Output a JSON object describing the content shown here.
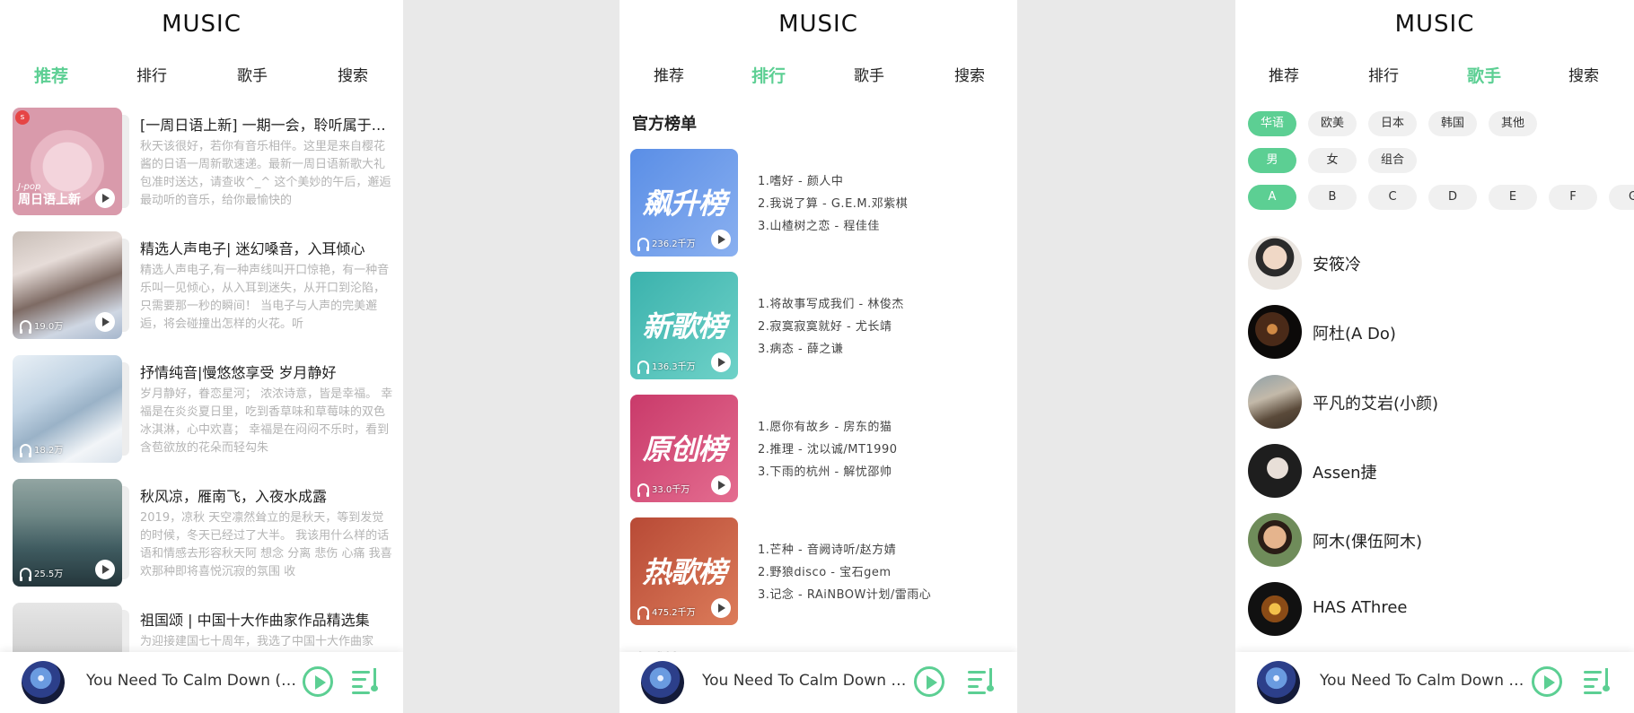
{
  "app_title": "MUSIC",
  "tabs": [
    "推荐",
    "排行",
    "歌手",
    "搜索"
  ],
  "recommend": {
    "items": [
      {
        "title": "[一周日语上新] 一期一会，聆听属于你的日语",
        "desc": "秋天该很好，若你有音乐相伴。这里是来自樱花酱的日语一周新歌速递。最新一周日语新歌大礼包准时送达，请查收^_^ 这个美妙的午后，邂逅最动听的音乐，给你最愉快的",
        "count": "",
        "cover_text": "周日语上新",
        "cover_small": "J-pop",
        "cover_badge": "s"
      },
      {
        "title": "精选人声电子| 迷幻嗓音，入耳倾心",
        "desc": "精选人声电子,有一种声线叫开口惊艳，有一种音乐叫一见倾心，从入耳到迷失，从开口到沦陷，只需要那一秒的瞬间！ 当电子与人声的完美邂逅，将会碰撞出怎样的火花。听",
        "count": "19.0万"
      },
      {
        "title": "抒情纯音|慢悠悠享受 岁月静好",
        "desc": "岁月静好，眷恋星河； 浓浓诗意，皆是幸福。 幸福是在炎炎夏日里，吃到香草味和草莓味的双色冰淇淋，心中欢喜； 幸福是在闷闷不乐时，看到含苞欲放的花朵而轻勾朱",
        "count": "18.2万"
      },
      {
        "title": "秋风凉，雁南飞，入夜水成露",
        "desc": "2019，凉秋 天空凛然耸立的是秋天，等到发觉的时候，冬天已经过了大半。 我该用什么样的话语和情感去形容秋天阿 想念 分离 悲伤 心痛 我喜欢那种即将喜悦沉寂的氛围 收",
        "count": "25.5万"
      },
      {
        "title": "祖国颂 | 中国十大作曲家作品精选集",
        "desc": "为迎接建国七十周年，我选了中国十大作曲家",
        "count": ""
      }
    ]
  },
  "rank": {
    "section_title": "官方榜单",
    "section_title_2": "全球榜",
    "items": [
      {
        "name": "飙升榜",
        "count": "236.2千万",
        "songs": [
          "1.嗜好 - 颜人中",
          "2.我说了算 - G.E.M.邓紫棋",
          "3.山楂树之恋 - 程佳佳"
        ]
      },
      {
        "name": "新歌榜",
        "count": "136.3千万",
        "songs": [
          "1.将故事写成我们 - 林俊杰",
          "2.寂寞寂寞就好 - 尤长靖",
          "3.病态 - 薛之谦"
        ]
      },
      {
        "name": "原创榜",
        "count": "33.0千万",
        "songs": [
          "1.愿你有故乡 - 房东的猫",
          "2.推理 - 沈以诚/MT1990",
          "3.下雨的杭州 - 解忧邵帅"
        ]
      },
      {
        "name": "热歌榜",
        "count": "475.2千万",
        "songs": [
          "1.芒种 - 音阙诗听/赵方婧",
          "2.野狼disco - 宝石gem",
          "3.记念 - RAiNBOW计划/雷雨心"
        ]
      }
    ]
  },
  "singer": {
    "regions": [
      "华语",
      "欧美",
      "日本",
      "韩国",
      "其他"
    ],
    "types": [
      "男",
      "女",
      "组合"
    ],
    "letters": [
      "A",
      "B",
      "C",
      "D",
      "E",
      "F",
      "G"
    ],
    "list": [
      "安筱冷",
      "阿杜(A Do)",
      "平凡的艾岩(小颜)",
      "Assen捷",
      "阿木(倮伍阿木)",
      "HAS AThree"
    ]
  },
  "player": {
    "title": "You Need To Calm Down (Clean Version)"
  },
  "colors": {
    "accent": "#5ccf93",
    "muted": "#b4b4b4"
  }
}
